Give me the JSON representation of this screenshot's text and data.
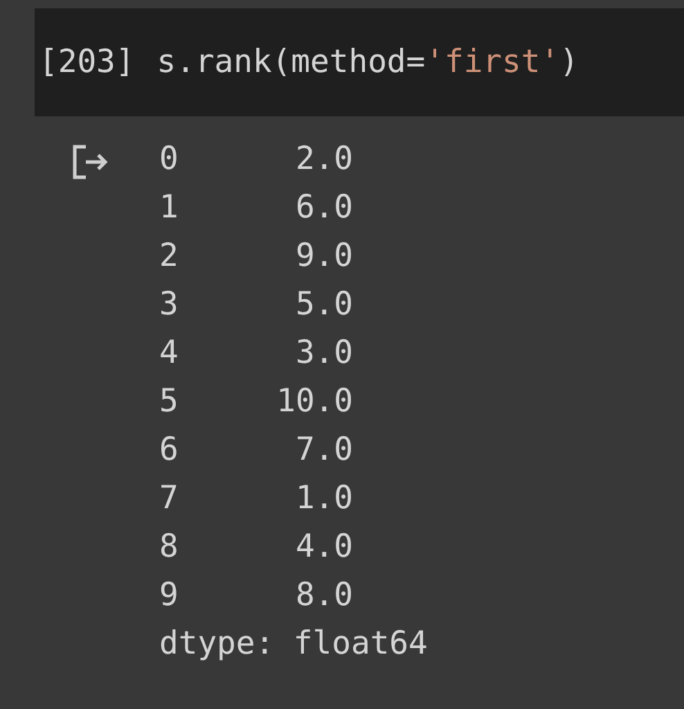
{
  "code_cell": {
    "execution_count": "[203]",
    "code": [
      {
        "text": "s.rank(method=",
        "kind": "plain"
      },
      {
        "text": "'first'",
        "kind": "string"
      },
      {
        "text": ")",
        "kind": "plain"
      }
    ]
  },
  "output": {
    "rows": [
      {
        "index": "0",
        "value": "2.0"
      },
      {
        "index": "1",
        "value": "6.0"
      },
      {
        "index": "2",
        "value": "9.0"
      },
      {
        "index": "3",
        "value": "5.0"
      },
      {
        "index": "4",
        "value": "3.0"
      },
      {
        "index": "5",
        "value": "10.0"
      },
      {
        "index": "6",
        "value": "7.0"
      },
      {
        "index": "7",
        "value": "1.0"
      },
      {
        "index": "8",
        "value": "4.0"
      },
      {
        "index": "9",
        "value": "8.0"
      }
    ],
    "dtype": "dtype: float64"
  }
}
